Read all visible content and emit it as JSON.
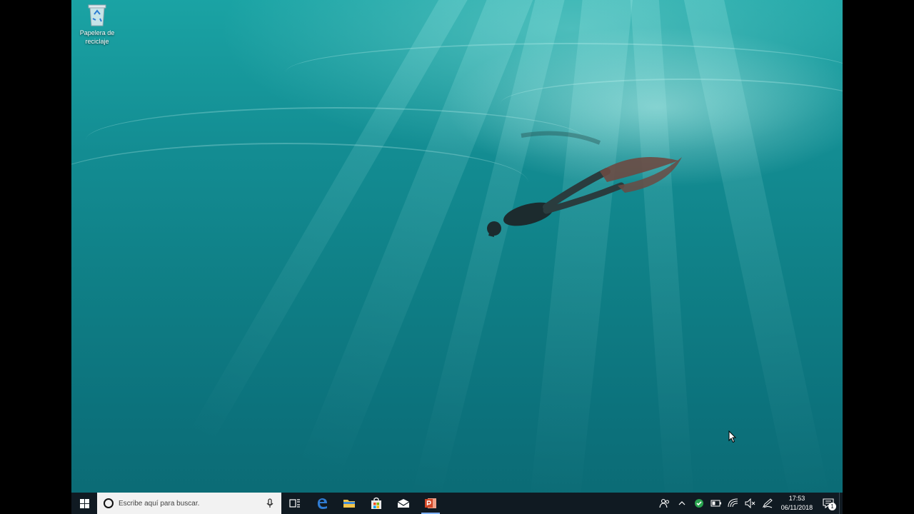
{
  "desktop": {
    "recycle_bin_label_line1": "Papelera de",
    "recycle_bin_label_line2": "reciclaje"
  },
  "taskbar": {
    "search_placeholder": "Escribe aquí para buscar.",
    "pinned_apps": [
      "task-view",
      "microsoft-edge",
      "file-explorer",
      "microsoft-store",
      "mail",
      "powerpoint"
    ],
    "active_app": "powerpoint"
  },
  "tray": {
    "time": "17:53",
    "date": "06/11/2018",
    "notification_count": "1"
  },
  "colors": {
    "taskbar": "#101a22",
    "accent": "#7fb2ff",
    "powerpoint": "#d24726",
    "edge": "#2f7cd3"
  }
}
